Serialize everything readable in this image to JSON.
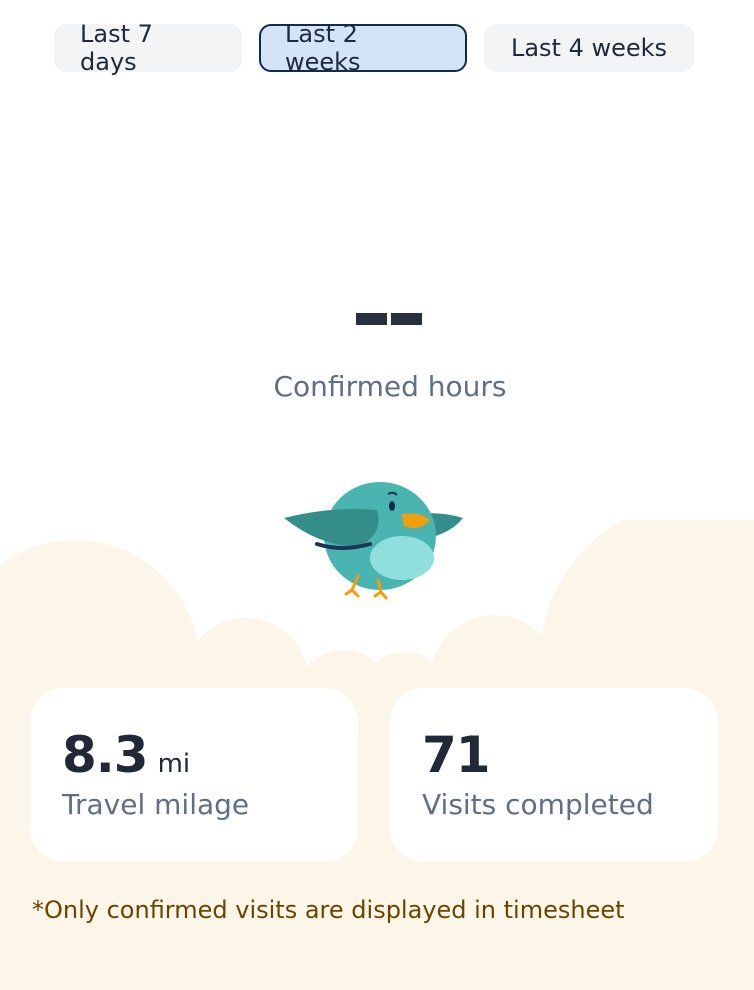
{
  "filters": [
    {
      "label": "Last 7 days",
      "selected": false
    },
    {
      "label": "Last 2 weeks",
      "selected": true
    },
    {
      "label": "Last 4 weeks",
      "selected": false
    }
  ],
  "hours": {
    "label": "Confirmed hours"
  },
  "stats": {
    "travel": {
      "value": "8.3",
      "unit": "mi",
      "label": "Travel milage"
    },
    "visits": {
      "value": "71",
      "label": "Visits completed"
    }
  },
  "footnote": "*Only confirmed visits are displayed in timesheet",
  "colors": {
    "selected_fill": "#d5e3f7",
    "selected_border": "#0f2a4a",
    "cloud": "#fcf6e8",
    "bird": "#4ab5b0",
    "footnote_text": "#6b4400"
  },
  "illustration": "bird-icon"
}
